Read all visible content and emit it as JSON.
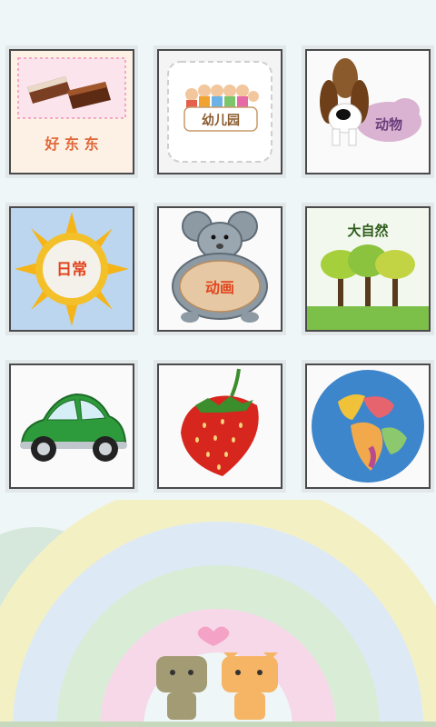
{
  "tiles": [
    {
      "id": "haodongdong",
      "label": "好 东 东"
    },
    {
      "id": "kindergarten",
      "label": "幼儿园"
    },
    {
      "id": "animals",
      "label": "动物"
    },
    {
      "id": "daily",
      "label": "日常"
    },
    {
      "id": "animation",
      "label": "动画"
    },
    {
      "id": "nature",
      "label": "大自然"
    },
    {
      "id": "car",
      "label": ""
    },
    {
      "id": "strawberry",
      "label": ""
    },
    {
      "id": "globe",
      "label": ""
    }
  ],
  "icons": [
    "chocolate-icon",
    "children-icon",
    "dog-icon",
    "sun-icon",
    "mouse-icon",
    "trees-icon",
    "car-icon",
    "strawberry-icon",
    "globe-icon"
  ],
  "colors": {
    "background": "#eef6f7",
    "tile_border": "#4a4a4a",
    "rainbow": [
      "#f3f0c4",
      "#dde9f5",
      "#d8ecd6",
      "#f6d8e8"
    ]
  }
}
